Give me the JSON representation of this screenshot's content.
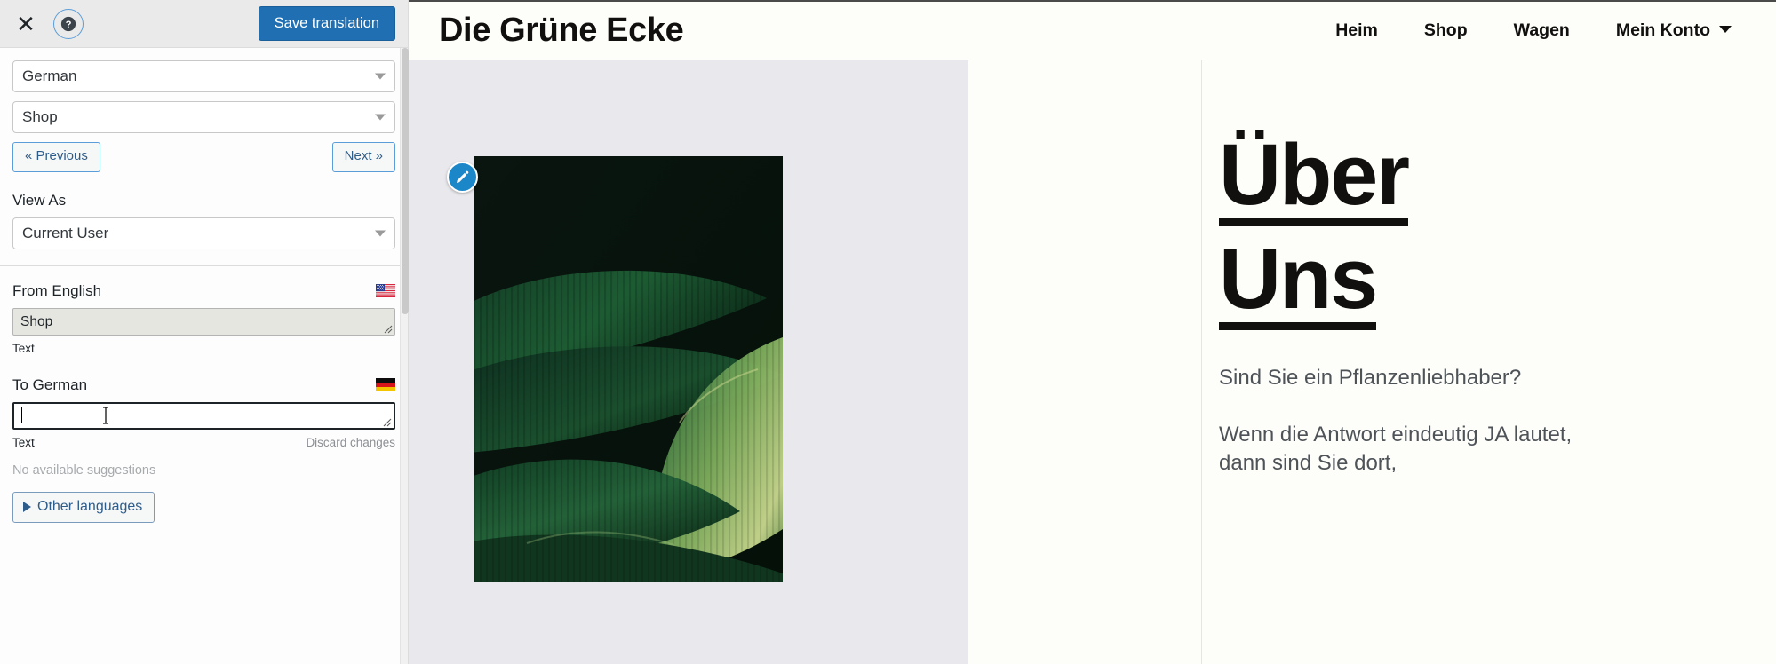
{
  "sidebar": {
    "header": {
      "close_icon": "close-icon",
      "help_icon": "help-icon",
      "save_label": "Save translation"
    },
    "language_select": {
      "value": "German",
      "icon": "chevron-down-icon"
    },
    "string_select": {
      "value": "Shop",
      "icon": "chevron-down-icon"
    },
    "previous_label": "« Previous",
    "next_label": "Next »",
    "view_as_label": "View As",
    "view_as_select": {
      "value": "Current User",
      "icon": "chevron-down-icon"
    },
    "source": {
      "title": "From English",
      "flag": "us-flag-icon",
      "value": "Shop",
      "meta": "Text"
    },
    "target": {
      "title": "To German",
      "flag": "de-flag-icon",
      "value": "",
      "meta": "Text",
      "discard_label": "Discard changes",
      "suggestions_label": "No available suggestions",
      "other_languages_label": "Other languages"
    }
  },
  "preview": {
    "site_title": "Die Grüne Ecke",
    "nav": [
      {
        "label": "Heim"
      },
      {
        "label": "Shop"
      },
      {
        "label": "Wagen"
      },
      {
        "label": "Mein Konto"
      }
    ],
    "edit_icon": "pencil-edit-icon",
    "hero_image_alt": "dark green tropical banana leaves photo",
    "heading_line1": "Über",
    "heading_line2": "Uns",
    "paragraphs": [
      "Sind Sie ein Pflanzenliebhaber?",
      "Wenn die Antwort eindeutig JA lautet, dann sind Sie dort,"
    ]
  },
  "colors": {
    "accent_blue": "#1f6fb2",
    "pencil_blue": "#1b87c9",
    "panel_gray": "#e9e9ed",
    "page_bg": "#fdfdfa",
    "text_dark": "#11100f",
    "text_muted": "#4e5358"
  }
}
